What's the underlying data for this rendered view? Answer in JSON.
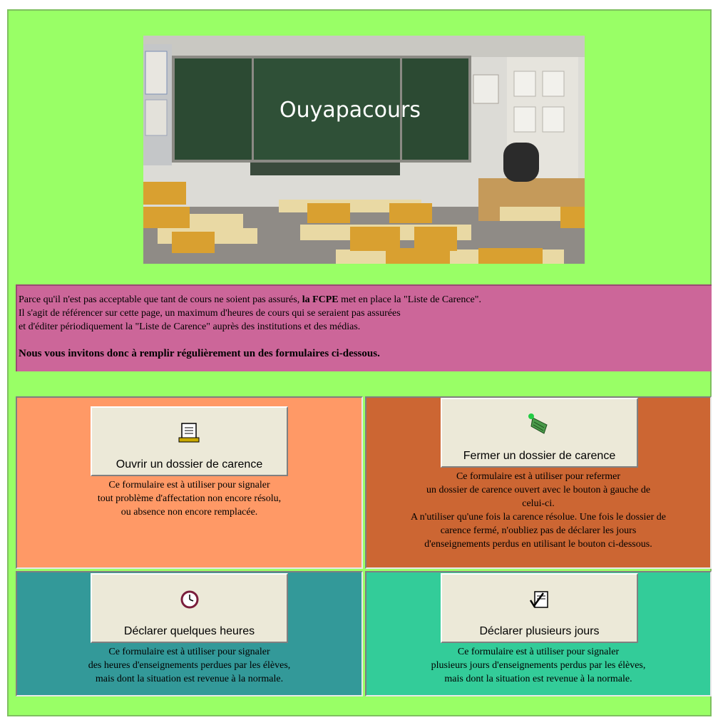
{
  "banner": {
    "title": "Ouyapacours"
  },
  "intro": {
    "line1_a": "Parce qu'il n'est pas acceptable que tant de cours ne soient pas assurés, ",
    "line1_bold": "la FCPE",
    "line1_b": " met en place la \"Liste de Carence\".",
    "line2": "Il s'agit de référencer sur cette page, un maximum d'heures de cours qui se seraient pas assurées",
    "line3": "et d'éditer périodiquement la \"Liste de Carence\" auprès des institutions et des médias.",
    "invite": "Nous vous invitons donc à remplir régulièrement un des formulaires ci-dessous."
  },
  "forms": {
    "open": {
      "button": "Ouvrir un dossier de carence",
      "icon": "document-list-icon",
      "desc": [
        "Ce formulaire est à utiliser pour signaler",
        "tout problème d'affectation non encore résolu,",
        "ou absence non encore remplacée."
      ]
    },
    "close": {
      "button": "Fermer un dossier de carence",
      "icon": "folder-close-icon",
      "desc": [
        "Ce formulaire est à utiliser pour refermer",
        "un dossier de carence ouvert avec le bouton à gauche de",
        "celui-ci.",
        "A n'utiliser qu'une fois la carence résolue. Une fois le dossier de",
        "carence fermé, n'oubliez pas de déclarer les jours",
        "d'enseignements perdus en utilisant le bouton ci-dessous."
      ]
    },
    "hours": {
      "button": "Déclarer quelques heures",
      "icon": "clock-icon",
      "desc": [
        "Ce formulaire est à utiliser pour signaler",
        "des heures d'enseignements perdues par les élèves,",
        "mais dont la situation est revenue à la normale."
      ]
    },
    "days": {
      "button": "Déclarer plusieurs jours",
      "icon": "calendar-check-icon",
      "desc": [
        "Ce formulaire est à utiliser pour signaler",
        "plusieurs jours d'enseignements perdus par les élèves,",
        "mais dont la situation est revenue à la normale."
      ]
    }
  },
  "colors": {
    "page_bg": "#99ff66",
    "intro_bg": "#cc6699",
    "open_bg": "#ff9966",
    "close_bg": "#cc6633",
    "hours_bg": "#339999",
    "days_bg": "#33cc99"
  }
}
